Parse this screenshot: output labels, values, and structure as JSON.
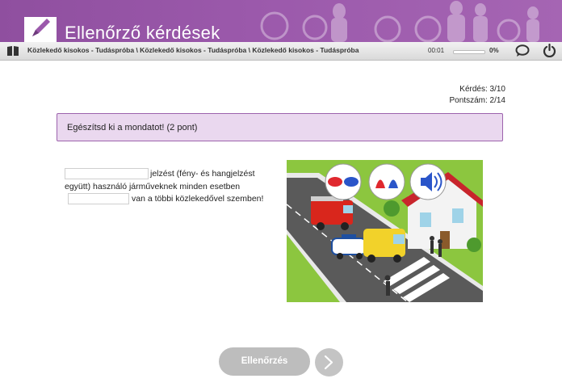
{
  "header": {
    "app_title": "Ellenőrző kérdések",
    "logo_icon": "pencil-icon",
    "brand_color": "#9b59ab"
  },
  "toolbar": {
    "menu_icon": "book-icon",
    "breadcrumb": "Közlekedő kisokos - Tudáspróba \\ Közlekedő kisokos - Tudáspróba \\ Közlekedő kisokos - Tudáspróba",
    "timer": "00:01",
    "progress": 0,
    "progress_label": "0%",
    "chat_icon": "chat-bubble-icon",
    "exit_icon": "power-icon"
  },
  "score": {
    "question": "Kérdés: 3/10",
    "points": "Pontszám: 2/14"
  },
  "instruction": "Egészítsd ki a mondatot! (2 pont)",
  "question": {
    "part1": "jelzést (fény- és hangjelzést együtt) használó járműveknek minden esetben",
    "part2": "van a többi közlekedővel szemben!",
    "blank1_value": "",
    "blank2_value": ""
  },
  "buttons": {
    "check_label": "Ellenőrzés",
    "next_icon": "chevron-right-icon"
  }
}
